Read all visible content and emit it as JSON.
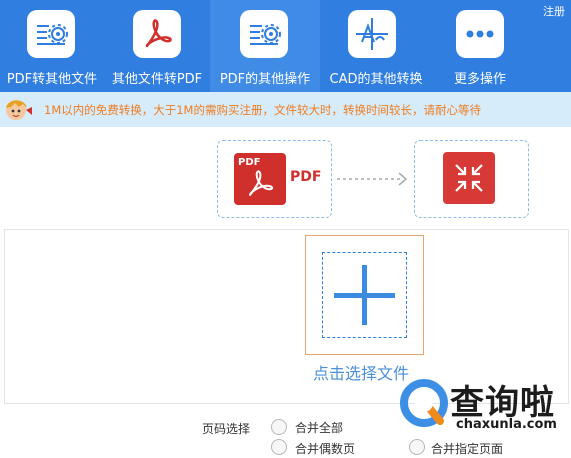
{
  "header": {
    "register_label": "注册",
    "tabs": [
      {
        "label": "PDF转其他文件",
        "icon": "gear-document-icon",
        "active": false
      },
      {
        "label": "其他文件转PDF",
        "icon": "pdf-symbol-icon",
        "active": false
      },
      {
        "label": "PDF的其他操作",
        "icon": "gear-document-icon",
        "active": true
      },
      {
        "label": "CAD的其他转换",
        "icon": "cad-drawing-icon",
        "active": false
      },
      {
        "label": "更多操作",
        "icon": "more-dots-icon",
        "active": false
      }
    ],
    "accent_color": "#2f7ee0"
  },
  "notice": {
    "text": "1M以内的免费转换，大于1M的需购买注册，文件较大时，转换时间较长，请耐心等待",
    "text_color": "#f07c1d"
  },
  "conversion": {
    "source_tag": "PDF",
    "source_label": "PDF",
    "target_icon": "compress-arrows-icon"
  },
  "upload": {
    "label": "点击选择文件"
  },
  "options": {
    "label": "页码选择",
    "choices": [
      "合并全部",
      "合并偶数页",
      "合并指定页面"
    ]
  },
  "watermark": {
    "name": "查询啦",
    "domain": "chaxunla.com"
  }
}
